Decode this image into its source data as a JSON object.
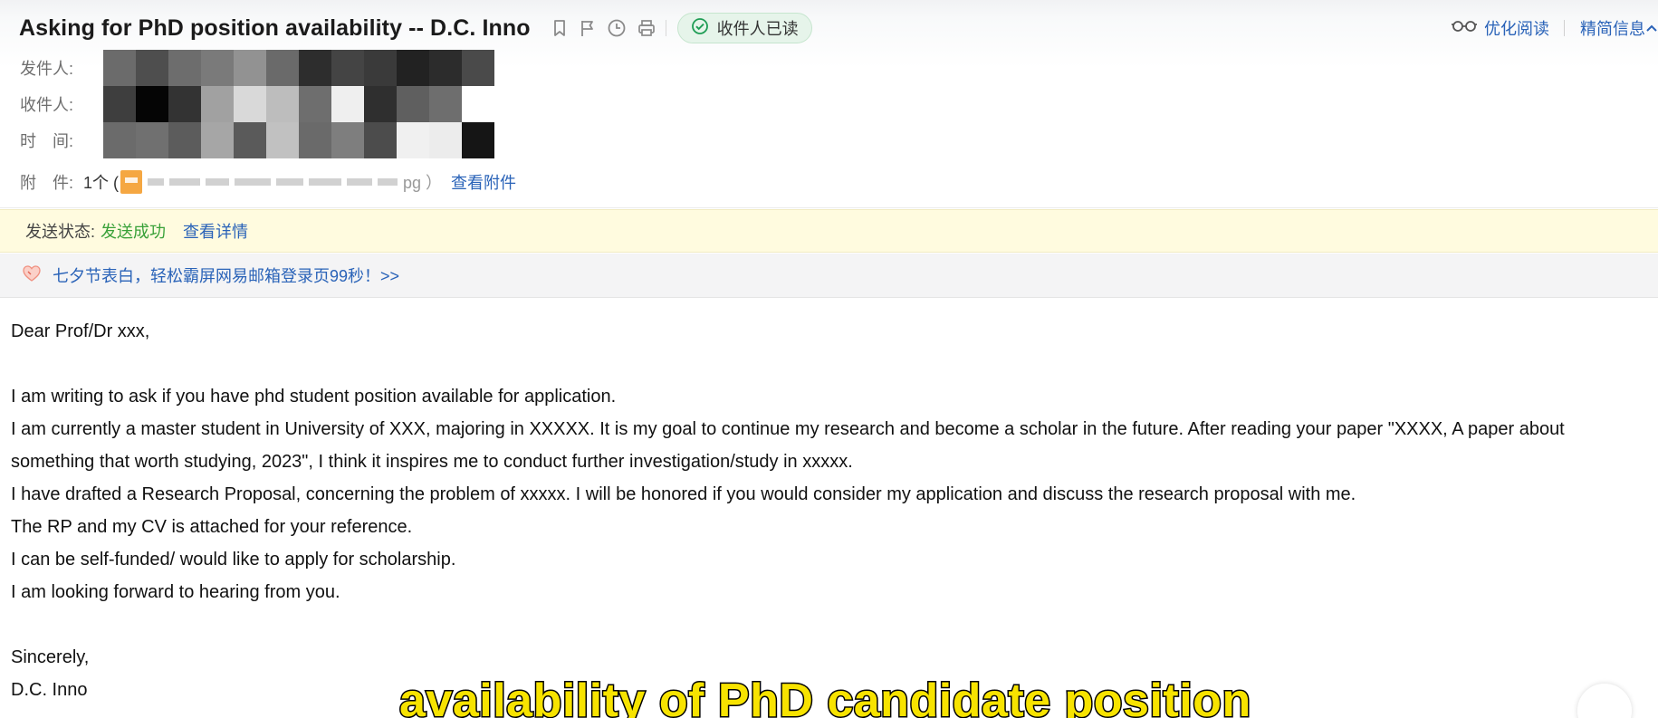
{
  "mail": {
    "subject": "Asking for PhD position availability -- D.C. Inno",
    "read_badge": "收件人已读",
    "optimize_read": "优化阅读",
    "simple_info": "精简信息"
  },
  "meta": {
    "from_label": "发件人:",
    "to_label": "收件人:",
    "time_label": "时　间:",
    "attach_label": "附　件:",
    "attach_count": "1个 (",
    "attach_ext": "pg ）",
    "view_attachments": "查看附件"
  },
  "status": {
    "label": "发送状态:",
    "value": "发送成功",
    "details_link": "查看详情",
    "ok_color": "#39a139"
  },
  "promo": {
    "text": "七夕节表白，轻松霸屏网易邮箱登录页99秒！>>"
  },
  "body_lines": [
    "Dear Prof/Dr xxx,",
    "",
    "I am writing to ask if you have phd student position available for application.",
    "I am currently a master student in University of XXX, majoring in XXXXX. It is my goal to continue my research and become a scholar in the future. After reading your paper \"XXXX, A paper about",
    "something that worth studying, 2023\", I think it inspires me to conduct further investigation/study in xxxxx.",
    "I have drafted a Research Proposal, concerning the problem of xxxxx. I will be honored if you would consider my application and discuss the research proposal with me.",
    "The RP and my CV is attached for your reference.",
    "I can be self-funded/ would like to apply for scholarship.",
    "I am looking forward to hearing from you.",
    "",
    "Sincerely,",
    "D.C. Inno"
  ],
  "caption": "availability of PhD candidate position",
  "icons": [
    "bookmark-icon",
    "flag-icon",
    "clock-icon",
    "print-icon",
    "check-circle-icon",
    "glasses-icon",
    "chevron-up-icon",
    "attachment-file-icon",
    "heart-promo-icon"
  ],
  "colors": {
    "link": "#2a63b8",
    "badge_bg": "#e6f4ea",
    "caption": "#f7e300"
  }
}
